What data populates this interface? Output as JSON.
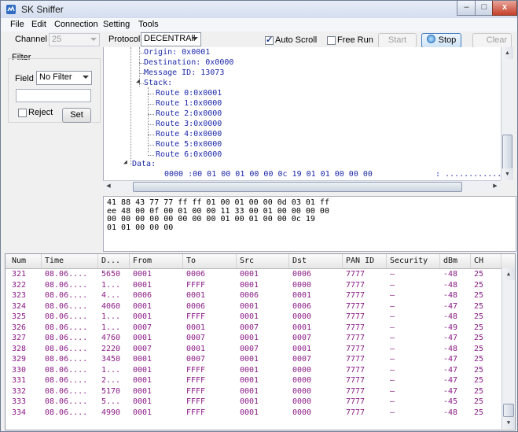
{
  "window": {
    "title": "SK Sniffer",
    "min": "–",
    "max": "□",
    "close": "x"
  },
  "menu": [
    "File",
    "Edit",
    "Connection",
    "Setting",
    "Tools"
  ],
  "toolbar": {
    "channel_label": "Channel",
    "channel_value": "25",
    "protocol_label": "Protocol",
    "protocol_value": "DECENTRAll",
    "auto_scroll_label": "Auto Scroll",
    "auto_scroll_checked": true,
    "free_run_label": "Free Run",
    "free_run_checked": false,
    "start_label": "Start",
    "stop_label": "Stop",
    "clear_label": "Clear"
  },
  "filter": {
    "title": "Filter",
    "field_label": "Field",
    "field_value": "No Filter",
    "text_value": "",
    "reject_label": "Reject",
    "set_label": "Set"
  },
  "tree": {
    "origin": "Origin: 0x0001",
    "destination": "Destination: 0x0000",
    "message_id": "Message ID: 13073",
    "stack": "Stack:",
    "routes": [
      "Route 0:0x0001",
      "Route 1:0x0000",
      "Route 2:0x0000",
      "Route 3:0x0000",
      "Route 4:0x0000",
      "Route 5:0x0000",
      "Route 6:0x0000"
    ],
    "data": "Data:",
    "data_row": "0000 :00 01 00 01 00 00 0c 19 01 01 00 00 00",
    "data_ascii": ": ............."
  },
  "hex_dump": "41 88 43 77 77 ff ff 01 00 01 00 00 0d 03 01 ff\nee 48 00 0f 00 01 00 00 11 33 00 01 00 00 00 00\n00 00 00 00 00 00 00 00 01 00 01 00 00 0c 19\n01 01 00 00 00",
  "grid": {
    "columns": [
      "Num",
      "Time",
      "D...",
      "From",
      "To",
      "Src",
      "Dst",
      "PAN ID",
      "Security",
      "dBm",
      "CH"
    ],
    "rows": [
      [
        "321",
        "08.06....",
        "5650",
        "0001",
        "0006",
        "0001",
        "0006",
        "7777",
        "–",
        "-48",
        "25"
      ],
      [
        "322",
        "08.06....",
        "1...",
        "0001",
        "FFFF",
        "0001",
        "0000",
        "7777",
        "–",
        "-48",
        "25"
      ],
      [
        "323",
        "08.06....",
        "4...",
        "0006",
        "0001",
        "0006",
        "0001",
        "7777",
        "–",
        "-48",
        "25"
      ],
      [
        "324",
        "08.06....",
        "4060",
        "0001",
        "0006",
        "0001",
        "0006",
        "7777",
        "–",
        "-47",
        "25"
      ],
      [
        "325",
        "08.06....",
        "1...",
        "0001",
        "FFFF",
        "0001",
        "0000",
        "7777",
        "–",
        "-48",
        "25"
      ],
      [
        "326",
        "08.06....",
        "1...",
        "0007",
        "0001",
        "0007",
        "0001",
        "7777",
        "–",
        "-49",
        "25"
      ],
      [
        "327",
        "08.06....",
        "4760",
        "0001",
        "0007",
        "0001",
        "0007",
        "7777",
        "–",
        "-47",
        "25"
      ],
      [
        "328",
        "08.06....",
        "2220",
        "0007",
        "0001",
        "0007",
        "0001",
        "7777",
        "–",
        "-48",
        "25"
      ],
      [
        "329",
        "08.06....",
        "3450",
        "0001",
        "0007",
        "0001",
        "0007",
        "7777",
        "–",
        "-47",
        "25"
      ],
      [
        "330",
        "08.06....",
        "1...",
        "0001",
        "FFFF",
        "0001",
        "0000",
        "7777",
        "–",
        "-47",
        "25"
      ],
      [
        "331",
        "08.06....",
        "2...",
        "0001",
        "FFFF",
        "0001",
        "0000",
        "7777",
        "–",
        "-47",
        "25"
      ],
      [
        "332",
        "08.06....",
        "5170",
        "0001",
        "FFFF",
        "0001",
        "0000",
        "7777",
        "–",
        "-47",
        "25"
      ],
      [
        "333",
        "08.06....",
        "5...",
        "0001",
        "FFFF",
        "0001",
        "0000",
        "7777",
        "–",
        "-45",
        "25"
      ],
      [
        "334",
        "08.06....",
        "4990",
        "0001",
        "FFFF",
        "0001",
        "0000",
        "7777",
        "–",
        "-48",
        "25"
      ]
    ]
  },
  "icons": {
    "app": "app-icon",
    "expand": "collapse-triangle-icon",
    "stop": "stop-circle-icon"
  },
  "colors": {
    "tree_text": "#1e2aa8",
    "grid_text": "#8a1a86"
  }
}
